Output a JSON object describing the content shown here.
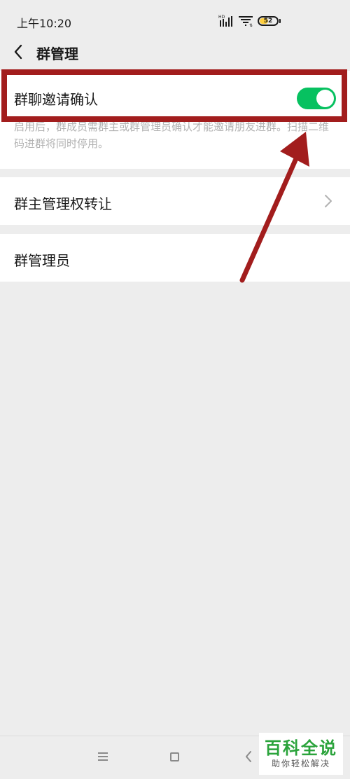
{
  "status_bar": {
    "time": "上午10:20",
    "network_label": "HD",
    "battery_level": "52",
    "battery_fill_color": "#ffcf3f"
  },
  "header": {
    "title": "群管理",
    "back_icon": "chevron-left-icon"
  },
  "settings": {
    "invite_confirm": {
      "label": "群聊邀请确认",
      "toggle_on": true,
      "toggle_color": "#07c160",
      "description": "启用后，群成员需群主或群管理员确认才能邀请朋友进群。扫描二维码进群将同时停用。"
    },
    "transfer_owner": {
      "label": "群主管理权转让",
      "chevron_icon": "chevron-right-icon"
    },
    "admins": {
      "label": "群管理员"
    }
  },
  "annotation": {
    "color": "#a21d1d"
  },
  "nav_bar": {
    "menu_icon": "menu-icon",
    "home_icon": "home-square-icon",
    "back_icon": "back-triangle-icon"
  },
  "watermark": {
    "title": "百科全说",
    "subtitle": "助你轻松解决"
  }
}
